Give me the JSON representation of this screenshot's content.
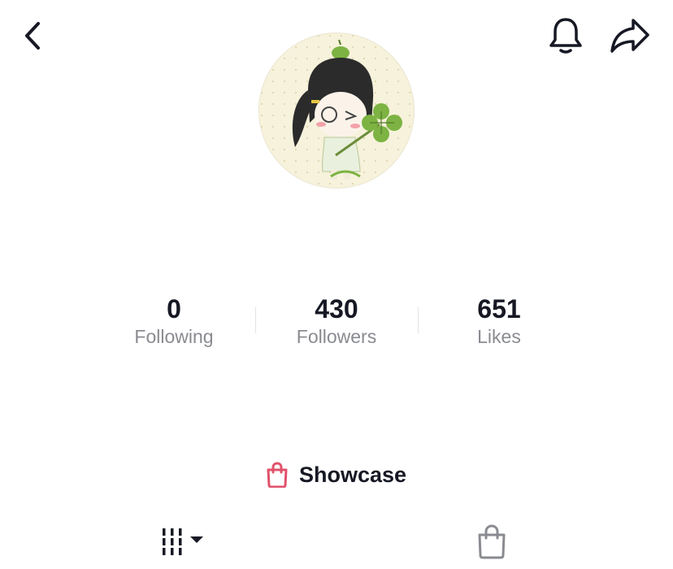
{
  "header": {
    "icons": [
      "chevron-left-icon",
      "bell-icon",
      "share-arrow-icon"
    ]
  },
  "profile": {
    "avatar_icon": "avatar-illustration"
  },
  "stats": [
    {
      "value": "0",
      "label": "Following"
    },
    {
      "value": "430",
      "label": "Followers"
    },
    {
      "value": "651",
      "label": "Likes"
    }
  ],
  "showcase": {
    "label": "Showcase",
    "icon": "shopping-bag-icon",
    "icon_color": "#e0526b"
  },
  "tabs": {
    "videos_icon": "video-grid-dropdown-icon",
    "shop_icon": "shopping-bag-outline-icon",
    "shop_icon_color": "#8a8b91"
  },
  "colors": {
    "text_primary": "#161823",
    "text_secondary": "#8a8b91",
    "avatar_bg": "#f7f2db",
    "clover_green": "#7cb342"
  }
}
